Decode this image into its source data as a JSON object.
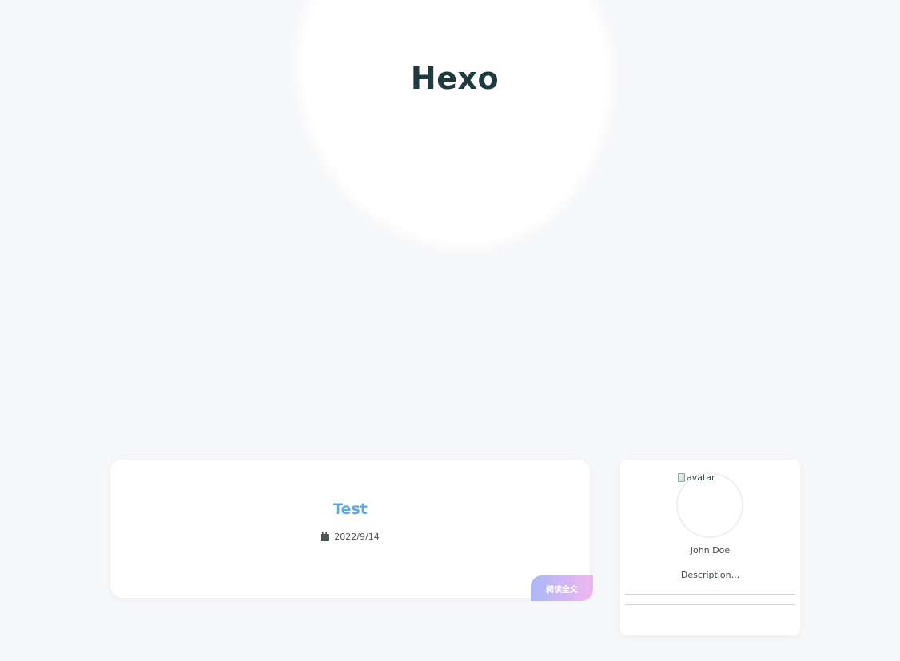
{
  "header": {
    "site_title": "Hexo"
  },
  "post": {
    "title": "Test",
    "date": "2022/9/14",
    "date_icon": "calendar-icon",
    "read_more_label": "阅读全文"
  },
  "profile": {
    "avatar_alt": "avatar",
    "name": "John Doe",
    "description": "Description..."
  },
  "colors": {
    "background": "#f6f7f9",
    "title": "#1e3a3e",
    "post_title": "#5ea9ec",
    "read_more_gradient_start": "#a9b8f6",
    "read_more_gradient_end": "#f0b8ee"
  }
}
